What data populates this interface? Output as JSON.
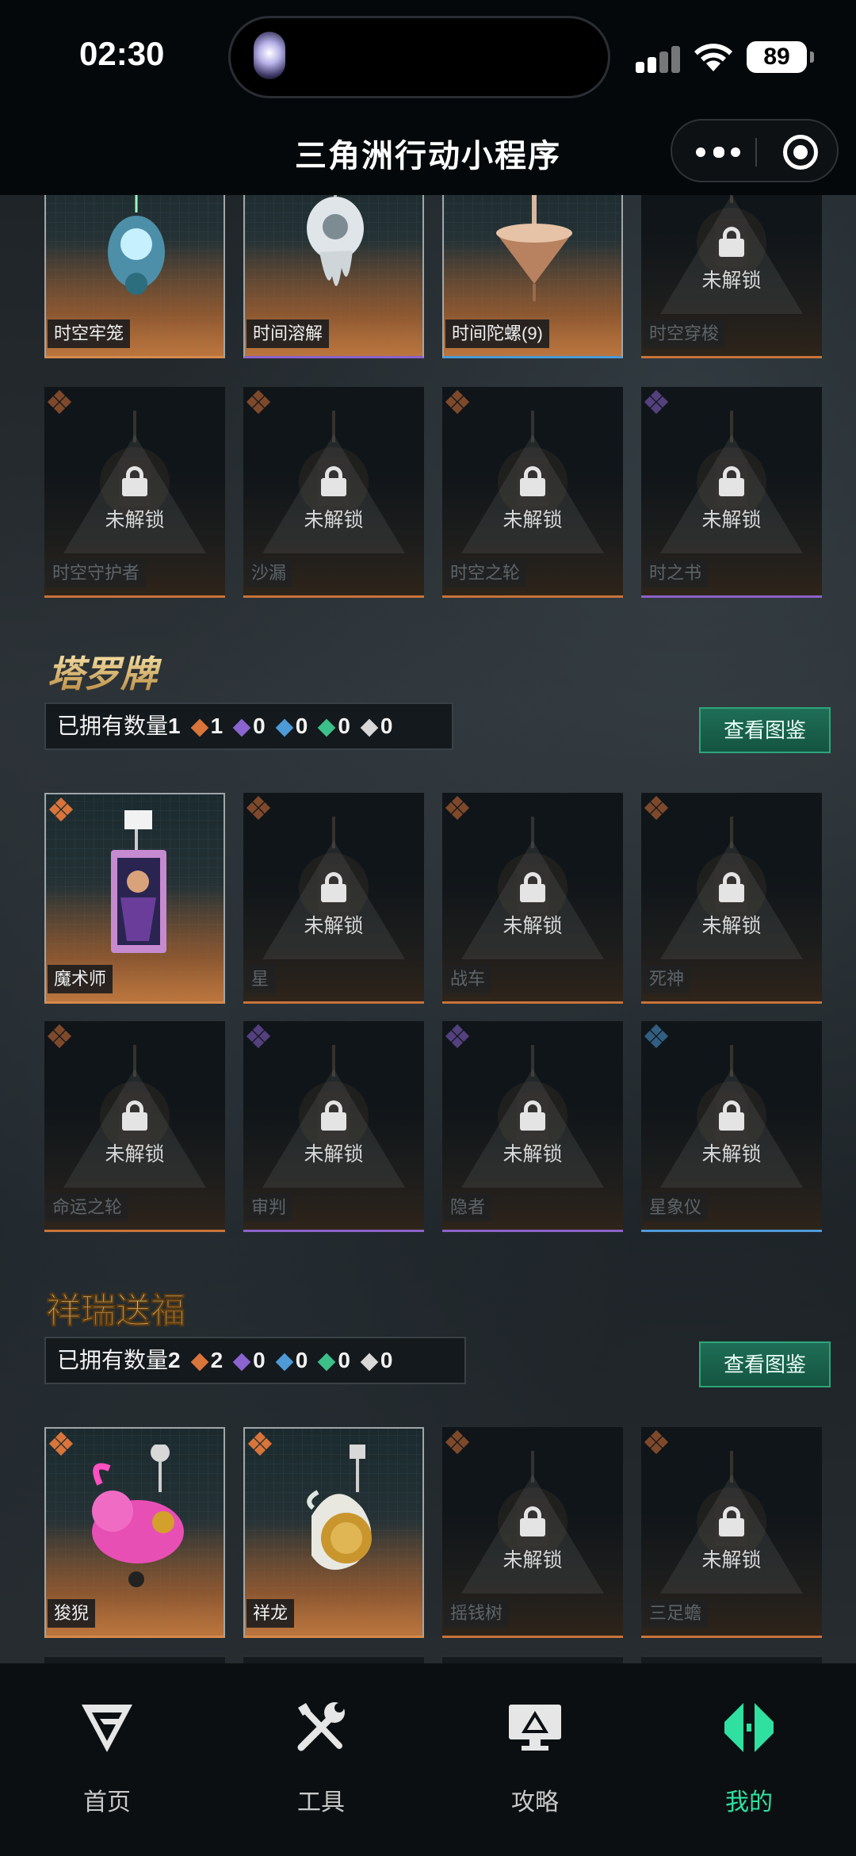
{
  "status_bar": {
    "time": "02:30",
    "battery": "89"
  },
  "nav": {
    "title": "三角洲行动小程序"
  },
  "lock_text": "未解锁",
  "top_rows": [
    [
      {
        "name": "时空牢笼",
        "state": "owned",
        "rarity": "orange",
        "border": "orange"
      },
      {
        "name": "时间溶解",
        "state": "owned",
        "rarity": "purple",
        "border": "purple"
      },
      {
        "name": "时间陀螺(9)",
        "state": "owned",
        "rarity": "blue",
        "border": "blue"
      },
      {
        "name": "时空穿梭",
        "state": "locked",
        "rarity": "orange",
        "border": "orange"
      }
    ],
    [
      {
        "name": "时空守护者",
        "state": "locked",
        "rarity": "orange",
        "border": "orange"
      },
      {
        "name": "沙漏",
        "state": "locked",
        "rarity": "orange",
        "border": "orange"
      },
      {
        "name": "时空之轮",
        "state": "locked",
        "rarity": "orange",
        "border": "orange"
      },
      {
        "name": "时之书",
        "state": "locked",
        "rarity": "purple",
        "border": "purple"
      }
    ]
  ],
  "sets": [
    {
      "banner": "塔罗牌",
      "owned_label": "已拥有数量",
      "owned_count": "1",
      "rarity_counts": [
        {
          "color": "orange",
          "value": "1"
        },
        {
          "color": "purple",
          "value": "0"
        },
        {
          "color": "blue",
          "value": "0"
        },
        {
          "color": "green",
          "value": "0"
        },
        {
          "color": "white",
          "value": "0"
        }
      ],
      "view_button": "查看图鉴",
      "rows": [
        [
          {
            "name": "魔术师",
            "state": "owned",
            "rarity": "orange",
            "border": "orange"
          },
          {
            "name": "星",
            "state": "locked",
            "rarity": "orange",
            "border": "orange"
          },
          {
            "name": "战车",
            "state": "locked",
            "rarity": "orange",
            "border": "orange"
          },
          {
            "name": "死神",
            "state": "locked",
            "rarity": "orange",
            "border": "orange"
          }
        ],
        [
          {
            "name": "命运之轮",
            "state": "locked",
            "rarity": "orange",
            "border": "orange"
          },
          {
            "name": "审判",
            "state": "locked",
            "rarity": "purple",
            "border": "purple"
          },
          {
            "name": "隐者",
            "state": "locked",
            "rarity": "purple",
            "border": "purple"
          },
          {
            "name": "星象仪",
            "state": "locked",
            "rarity": "blue",
            "border": "blue"
          }
        ]
      ]
    },
    {
      "banner": "祥瑞送福",
      "owned_label": "已拥有数量",
      "owned_count": "2",
      "rarity_counts": [
        {
          "color": "orange",
          "value": "2"
        },
        {
          "color": "purple",
          "value": "0"
        },
        {
          "color": "blue",
          "value": "0"
        },
        {
          "color": "green",
          "value": "0"
        },
        {
          "color": "white",
          "value": "0"
        }
      ],
      "view_button": "查看图鉴",
      "rows": [
        [
          {
            "name": "狻猊",
            "state": "owned",
            "rarity": "orange",
            "border": "orange"
          },
          {
            "name": "祥龙",
            "state": "owned",
            "rarity": "orange",
            "border": "orange"
          },
          {
            "name": "摇钱树",
            "state": "locked",
            "rarity": "orange",
            "border": "orange"
          },
          {
            "name": "三足蟾",
            "state": "locked",
            "rarity": "orange",
            "border": "orange"
          }
        ]
      ]
    }
  ],
  "tabs": [
    {
      "label": "首页",
      "icon": "delta-logo-icon",
      "active": false
    },
    {
      "label": "工具",
      "icon": "tools-icon",
      "active": false
    },
    {
      "label": "攻略",
      "icon": "guide-monitor-icon",
      "active": false
    },
    {
      "label": "我的",
      "icon": "profile-diamond-icon",
      "active": true
    }
  ]
}
